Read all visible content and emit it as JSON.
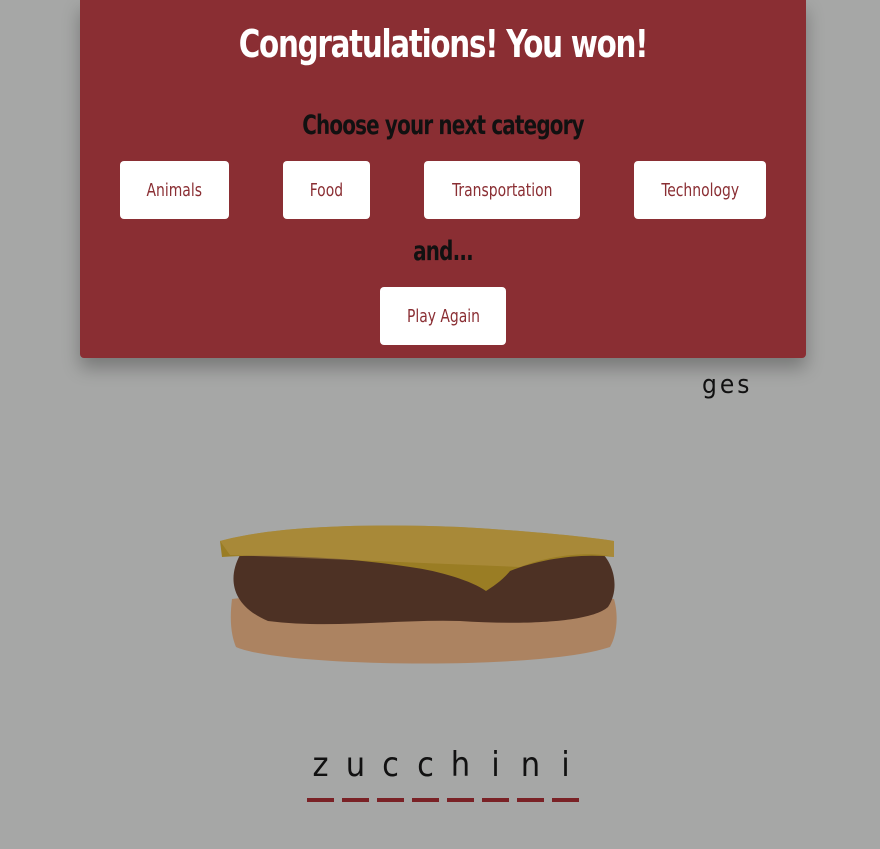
{
  "modal": {
    "title": "Congratulations! You won!",
    "subtitle": "Choose your next category",
    "categories": [
      "Animals",
      "Food",
      "Transportation",
      "Technology"
    ],
    "connector": "and...",
    "play_again_label": "Play Again"
  },
  "hint_text": "ges",
  "word": {
    "letters": [
      "z",
      "u",
      "c",
      "c",
      "h",
      "i",
      "n",
      "i"
    ]
  },
  "colors": {
    "background": "#a6a7a6",
    "modal": "#8a2e33",
    "button_text": "#8a2e33",
    "underline": "#7a2226"
  },
  "icons": {
    "illustration": "cheeseburger-icon"
  }
}
